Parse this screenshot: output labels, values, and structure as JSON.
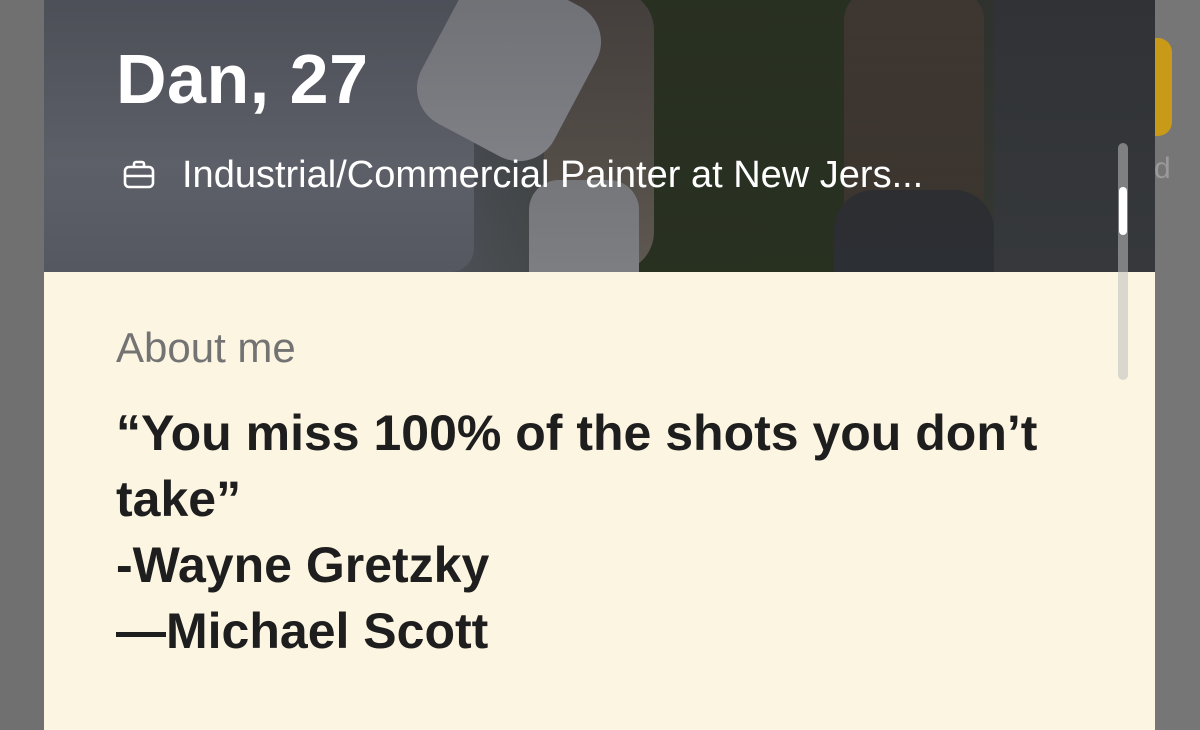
{
  "profile": {
    "name_age": "Dan, 27",
    "job": "Industrial/Commercial Painter at New Jers...",
    "job_icon": "briefcase-icon"
  },
  "about": {
    "label": "About me",
    "bio_lines": [
      "“You miss 100% of the shots you don’t",
      "take”",
      "-Wayne Gretzky",
      "—Michael Scott"
    ]
  },
  "next_card": {
    "peek_letter": "d"
  },
  "colors": {
    "about_background": "#fcf5e2",
    "accent_yellow": "#c99a18",
    "bio_text": "#1e1e1e",
    "label_text": "#737373"
  }
}
